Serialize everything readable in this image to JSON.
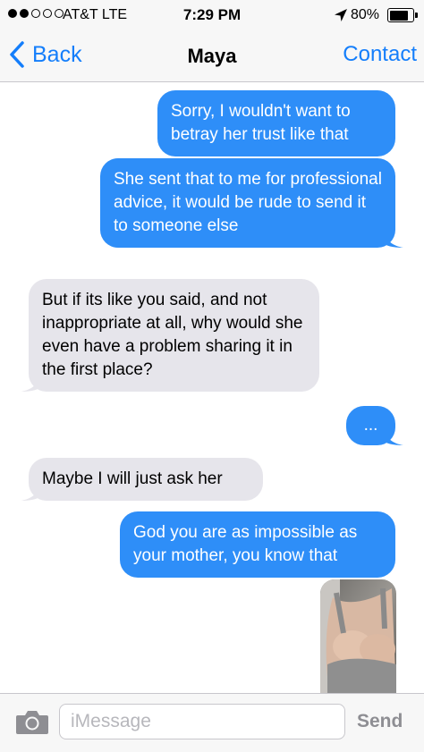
{
  "status_bar": {
    "carrier": "AT&T LTE",
    "signal_bars_filled": 2,
    "signal_bars_total": 5,
    "time": "7:29 PM",
    "location_icon": "location-arrow-icon",
    "battery_percent": "80%",
    "battery_level": 0.8
  },
  "nav": {
    "back_label": "Back",
    "title": "Maya",
    "contact_label": "Contact"
  },
  "messages": [
    {
      "side": "sent",
      "text": "Sorry, I wouldn't want to betray her trust like that"
    },
    {
      "side": "sent",
      "text": "She sent that to me for professional advice, it would be rude to send it to someone else"
    },
    {
      "side": "received",
      "text": "But if its like you said, and not inappropriate at all, why would she even have a problem sharing it in the first place?"
    },
    {
      "side": "sent",
      "text": "..."
    },
    {
      "side": "received",
      "text": "Maybe I will just ask her"
    },
    {
      "side": "sent",
      "text": "God you are as impossible as your mother, you know that"
    },
    {
      "side": "sent",
      "type": "image",
      "icon": "photo-attachment"
    }
  ],
  "input_bar": {
    "camera_icon": "camera-icon",
    "placeholder": "iMessage",
    "value": "",
    "send_label": "Send"
  },
  "colors": {
    "sent_bubble": "#2e8ef8",
    "received_bubble": "#e6e5eb",
    "accent": "#147efb",
    "send_disabled": "#8e8e93"
  }
}
